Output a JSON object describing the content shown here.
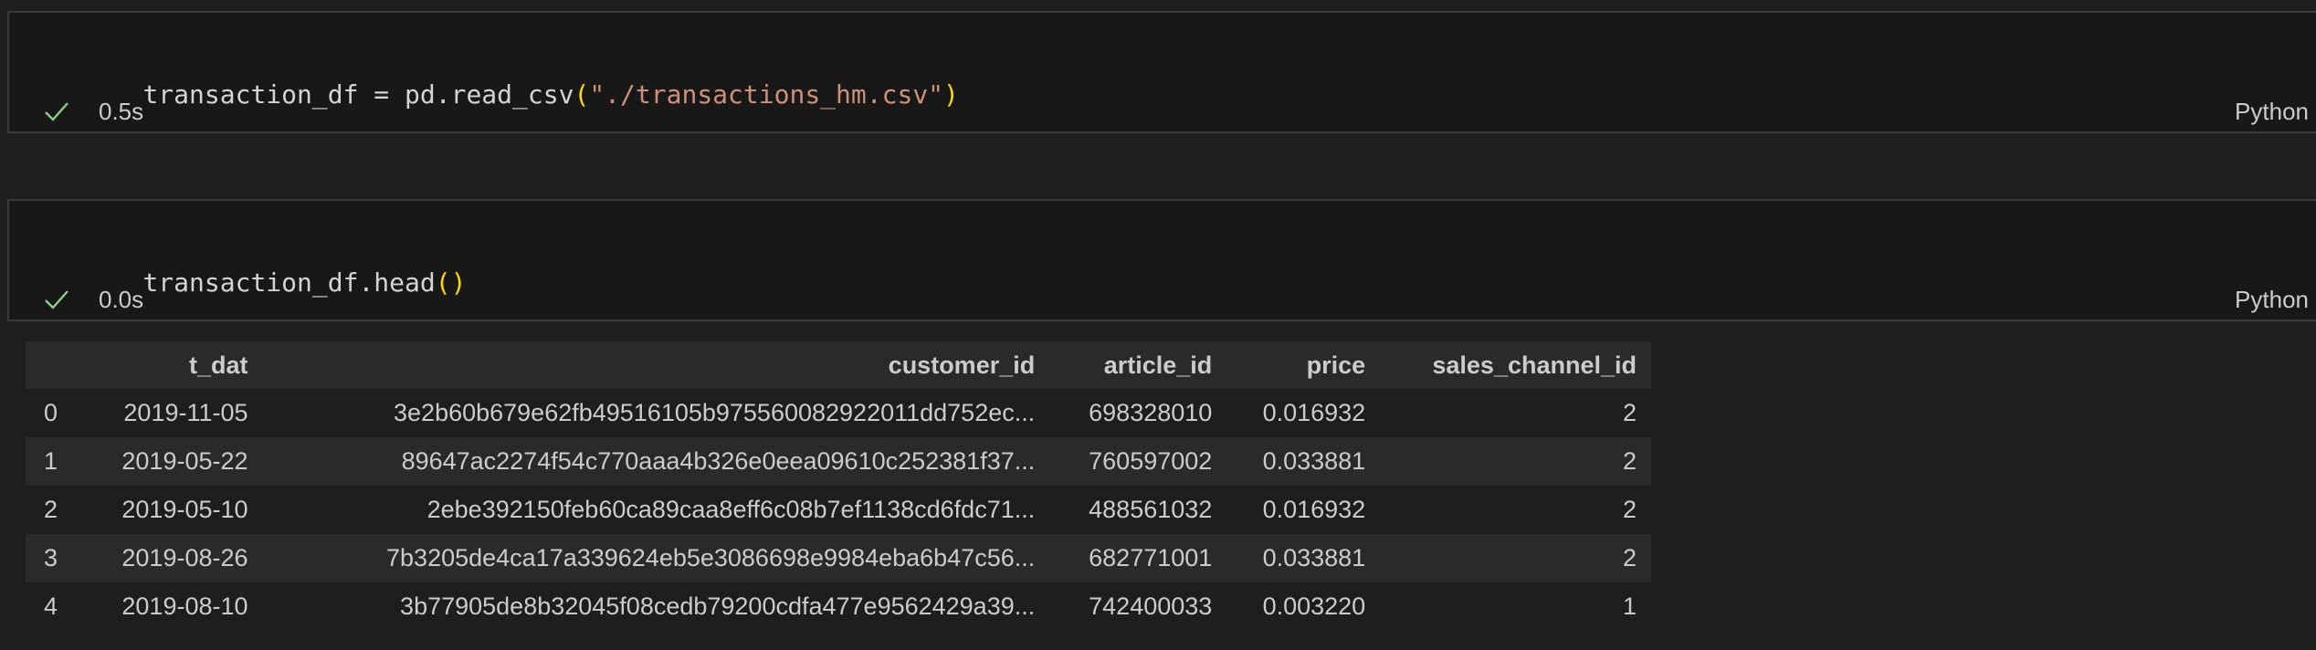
{
  "cells": [
    {
      "code_tokens": [
        {
          "text": "transaction_df = pd.read_csv",
          "kind": "plain"
        },
        {
          "text": "(",
          "kind": "paren"
        },
        {
          "text": "\"./transactions_hm.csv\"",
          "kind": "str"
        },
        {
          "text": ")",
          "kind": "paren"
        }
      ],
      "exec_time": "0.5s",
      "language": "Python"
    },
    {
      "code_tokens": [
        {
          "text": "transaction_df.head",
          "kind": "plain"
        },
        {
          "text": "()",
          "kind": "paren"
        }
      ],
      "exec_time": "0.0s",
      "language": "Python"
    }
  ],
  "output_table": {
    "columns": [
      "",
      "t_dat",
      "customer_id",
      "article_id",
      "price",
      "sales_channel_id"
    ],
    "rows": [
      [
        "0",
        "2019-11-05",
        "3e2b60b679e62fb49516105b975560082922011dd752ec...",
        "698328010",
        "0.016932",
        "2"
      ],
      [
        "1",
        "2019-05-22",
        "89647ac2274f54c770aaa4b326e0eea09610c252381f37...",
        "760597002",
        "0.033881",
        "2"
      ],
      [
        "2",
        "2019-05-10",
        "2ebe392150feb60ca89caa8eff6c08b7ef1138cd6fdc71...",
        "488561032",
        "0.016932",
        "2"
      ],
      [
        "3",
        "2019-08-26",
        "7b3205de4ca17a339624eb5e3086698e9984eba6b47c56...",
        "682771001",
        "0.033881",
        "2"
      ],
      [
        "4",
        "2019-08-10",
        "3b77905de8b32045f08cedb79200cdfa477e9562429a39...",
        "742400033",
        "0.003220",
        "1"
      ]
    ]
  },
  "colors": {
    "background": "#1e1e1e",
    "cell_border": "#3a3a3a",
    "check": "#89d185",
    "string": "#ce9178",
    "paren": "#ffd700",
    "header_bg": "#2a2a2a"
  },
  "icons": {
    "status": "check-icon"
  }
}
